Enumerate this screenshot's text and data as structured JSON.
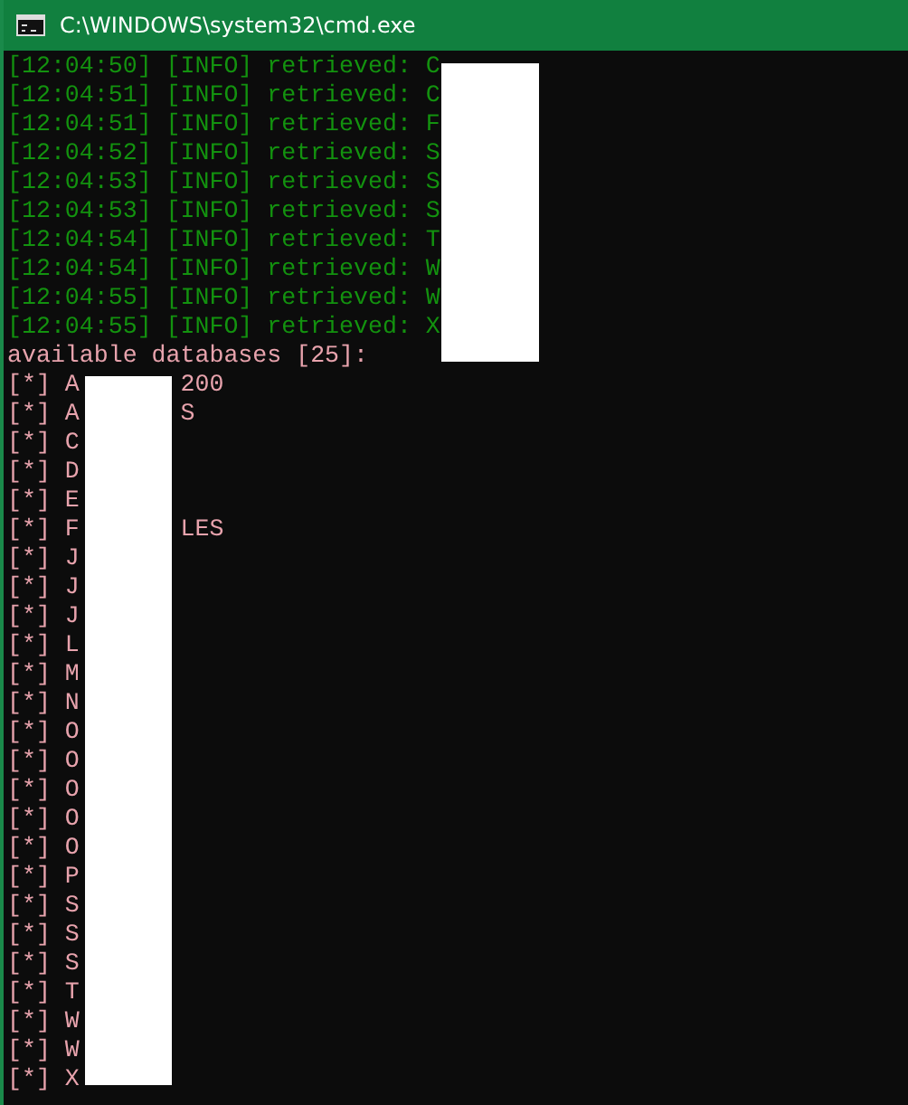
{
  "window": {
    "title": "C:\\WINDOWS\\system32\\cmd.exe"
  },
  "log_lines": [
    "[12:04:50] [INFO] retrieved: C",
    "[12:04:51] [INFO] retrieved: C",
    "[12:04:51] [INFO] retrieved: F",
    "[12:04:52] [INFO] retrieved: S",
    "[12:04:53] [INFO] retrieved: S",
    "[12:04:53] [INFO] retrieved: S",
    "[12:04:54] [INFO] retrieved: T",
    "[12:04:54] [INFO] retrieved: W",
    "[12:04:55] [INFO] retrieved: W",
    "[12:04:55] [INFO] retrieved: X"
  ],
  "databases_header": "available databases [25]:",
  "databases": [
    {
      "name": "[*] A",
      "tail": "200"
    },
    {
      "name": "[*] A",
      "tail": "S"
    },
    {
      "name": "[*] C"
    },
    {
      "name": "[*] D"
    },
    {
      "name": "[*] E"
    },
    {
      "name": "[*] F",
      "tail": "LES"
    },
    {
      "name": "[*] J"
    },
    {
      "name": "[*] J"
    },
    {
      "name": "[*] J"
    },
    {
      "name": "[*] L"
    },
    {
      "name": "[*] M"
    },
    {
      "name": "[*] N"
    },
    {
      "name": "[*] O"
    },
    {
      "name": "[*] O"
    },
    {
      "name": "[*] O"
    },
    {
      "name": "[*] O"
    },
    {
      "name": "[*] O"
    },
    {
      "name": "[*] P"
    },
    {
      "name": "[*] S"
    },
    {
      "name": "[*] S"
    },
    {
      "name": "[*] S"
    },
    {
      "name": "[*] T"
    },
    {
      "name": "[*] W"
    },
    {
      "name": "[*] W"
    },
    {
      "name": "[*] X"
    }
  ]
}
